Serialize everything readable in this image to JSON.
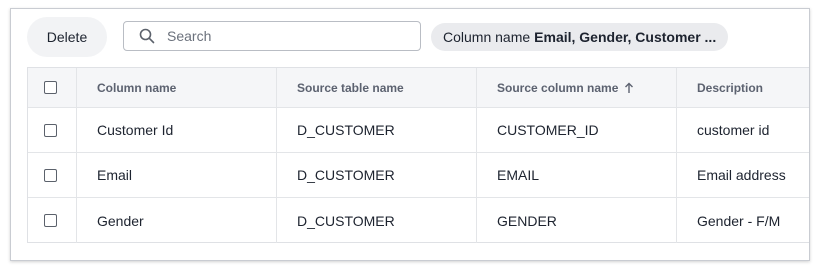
{
  "toolbar": {
    "delete_label": "Delete",
    "search_placeholder": "Search",
    "search_value": "",
    "filter_chip_label": "Column name",
    "filter_chip_value": "Email, Gender, Customer ..."
  },
  "table": {
    "headers": [
      "Column name",
      "Source table name",
      "Source column name",
      "Description"
    ],
    "sorted_column": "Source column name",
    "sort_direction": "ascending",
    "rows": [
      {
        "column_name": "Customer Id",
        "source_table": "D_CUSTOMER",
        "source_column": "CUSTOMER_ID",
        "description": "customer id"
      },
      {
        "column_name": "Email",
        "source_table": "D_CUSTOMER",
        "source_column": "EMAIL",
        "description": "Email address"
      },
      {
        "column_name": "Gender",
        "source_table": "D_CUSTOMER",
        "source_column": "GENDER",
        "description": "Gender - F/M"
      }
    ]
  },
  "icons": {
    "search": "search-icon",
    "sort": "arrow-up-icon"
  }
}
